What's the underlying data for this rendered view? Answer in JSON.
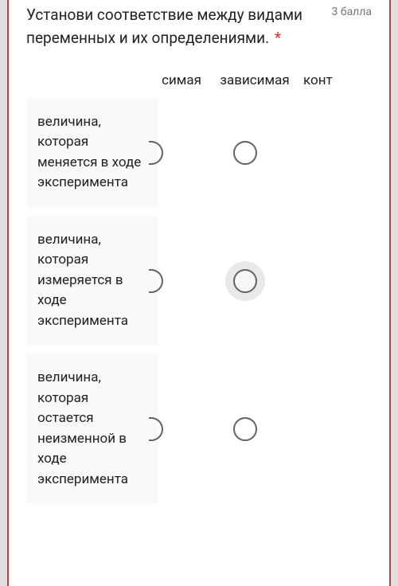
{
  "question": {
    "text": "Установи соответствие между видами переменных и их определениями.",
    "required_marker": "*",
    "points": "3 балла"
  },
  "columns": {
    "col1_partial": "симая",
    "col2": "зависимая",
    "col3_partial": "конт"
  },
  "rows": [
    {
      "label": "величина, которая меняется в ходе эксперимента"
    },
    {
      "label": "величина, которая измеряется в ходе эксперимента"
    },
    {
      "label": "величина, которая остается неизменной в ходе эксперимента"
    }
  ]
}
